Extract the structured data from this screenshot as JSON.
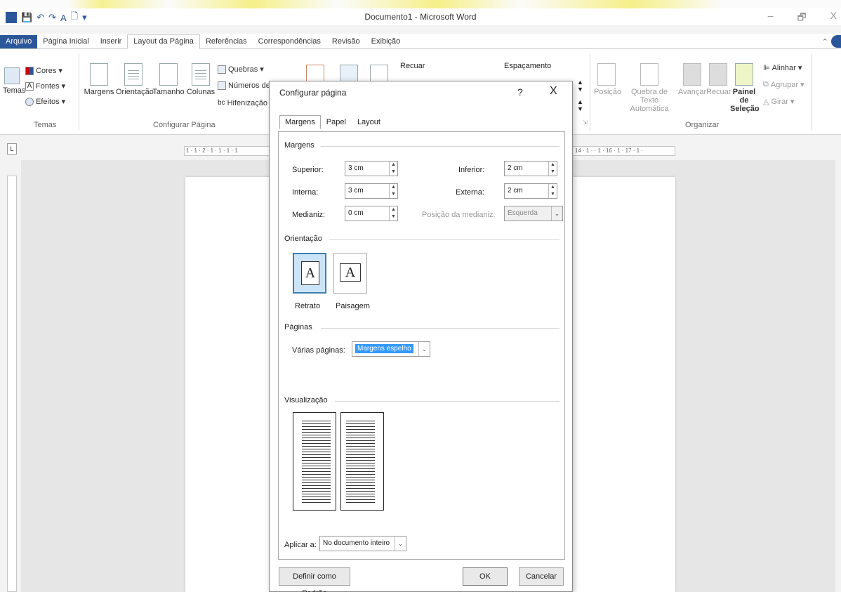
{
  "window": {
    "title": "Documento1 - Microsoft Word",
    "controls": {
      "minimize": "–",
      "restore": "🗗",
      "close": "X"
    }
  },
  "tabs": [
    "Arquivo",
    "Página Inicial",
    "Inserir",
    "Layout da Página",
    "Referências",
    "Correspondências",
    "Revisão",
    "Exibição"
  ],
  "ribbon": {
    "temas": {
      "button": "Temas",
      "cores": "Cores",
      "fontes": "Fontes",
      "efeitos": "Efeitos",
      "group": "Temas"
    },
    "config": {
      "margens": "Margens",
      "orientacao": "Orientação",
      "tamanho": "Tamanho",
      "colunas": "Colunas",
      "quebras": "Quebras",
      "numeros": "Números de Lin",
      "hifenizacao": "Hifenização",
      "group": "Configurar Página"
    },
    "recuar": "Recuar",
    "espacamento": "Espaçamento",
    "organizar": {
      "posicao": "Posição",
      "quebra": "Quebra de Texto",
      "automatica": "Automática",
      "avancar": "Avançar",
      "recuar": "Recuar",
      "painel1": "Painel de",
      "painel2": "Seleção",
      "alinhar": "Alinhar",
      "agrupar": "Agrupar",
      "girar": "Girar",
      "group": "Organizar"
    }
  },
  "ruler": {
    "left": "1 · 1 · 2 · 1 · 1 · 1 · 1",
    "right": "14 · 1 · · 1 · 16 · 1 · 17 · 1 ·"
  },
  "dialog": {
    "title": "Configurar página",
    "help": "?",
    "close": "X",
    "tabs": [
      "Margens",
      "Papel",
      "Layout"
    ],
    "sections": {
      "margens": "Margens",
      "orientacao": "Orientação",
      "paginas": "Páginas",
      "visualizacao": "Visualização"
    },
    "fields": {
      "superior": {
        "label": "Superior:",
        "value": "3 cm"
      },
      "interna": {
        "label": "Interna:",
        "value": "3 cm"
      },
      "medianiz": {
        "label": "Medianiz:",
        "value": "0 cm"
      },
      "inferior": {
        "label": "Inferior:",
        "value": "2 cm"
      },
      "externa": {
        "label": "Externa:",
        "value": "2 cm"
      },
      "posicao_medianiz": {
        "label": "Posição da medianiz:",
        "value": "Esquerda"
      }
    },
    "orientation": {
      "retrato": "Retrato",
      "paisagem": "Paisagem",
      "glyph": "A"
    },
    "varias_paginas": {
      "label": "Várias páginas:",
      "value": "Margens espelho"
    },
    "aplicar": {
      "label": "Aplicar a:",
      "value": "No documento inteiro"
    },
    "buttons": {
      "padrao": "Definir como Padrão",
      "ok": "OK",
      "cancelar": "Cancelar"
    }
  }
}
